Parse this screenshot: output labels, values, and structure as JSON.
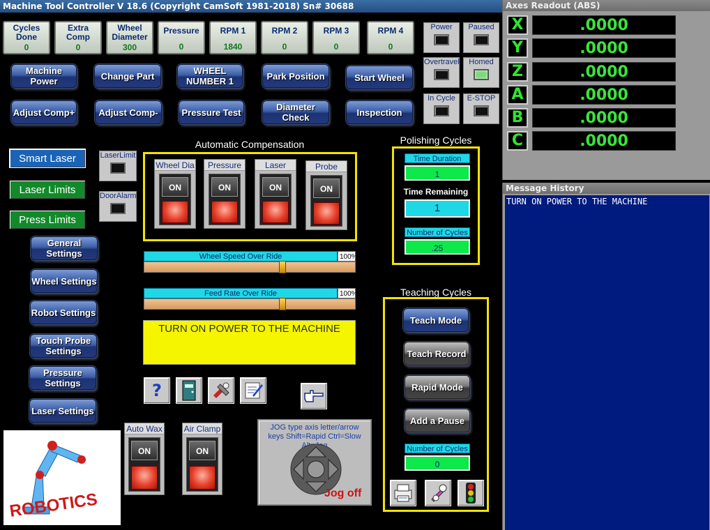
{
  "window_title": "Machine Tool Controller V 18.6 (Copyright CamSoft 1981-2018) Sn# 30688",
  "status": [
    {
      "label": "Cycles Done",
      "value": "0"
    },
    {
      "label": "Extra Comp",
      "value": "0"
    },
    {
      "label": "Wheel Diameter",
      "value": "300"
    },
    {
      "label": "Pressure",
      "value": "0"
    },
    {
      "label": "RPM 1",
      "value": "1840"
    },
    {
      "label": "RPM 2",
      "value": "0"
    },
    {
      "label": "RPM 3",
      "value": "0"
    },
    {
      "label": "RPM 4",
      "value": "0"
    }
  ],
  "indicators": {
    "power": "Power",
    "paused": "Paused",
    "overtravel": "Overtravel",
    "homed": "Homed",
    "in_cycle": "In Cycle",
    "estop": "E-STOP"
  },
  "buttons": {
    "machine_power": "Machine Power",
    "change_part": "Change Part",
    "wheel_number": "WHEEL NUMBER 1",
    "park_position": "Park Position",
    "start_wheel": "Start Wheel",
    "adjust_comp_plus": "Adjust Comp+",
    "adjust_comp_minus": "Adjust Comp-",
    "pressure_test": "Pressure Test",
    "diameter_check": "Diameter Check",
    "inspection": "Inspection"
  },
  "left_menu": {
    "smart_laser": "Smart Laser",
    "laser_limits": "Laser Limits",
    "press_limits": "Press Limits",
    "laser_limit_ind": "LaserLimit",
    "door_alarm_ind": "DoorAlarm"
  },
  "settings_buttons": [
    "General Settings",
    "Wheel Settings",
    "Robot Settings",
    "Touch Probe Settings",
    "Pressure Settings",
    "Laser Settings"
  ],
  "auto_comp": {
    "title": "Automatic Compensation",
    "toggles": [
      "Wheel Dia",
      "Pressure",
      "Laser",
      "Probe"
    ],
    "on_label": "ON"
  },
  "sliders": {
    "wheel_speed": {
      "label": "Wheel Speed Over Ride",
      "pct": "100%",
      "level": 0.66
    },
    "feed_rate": {
      "label": "Feed Rate Over Ride",
      "pct": "100%",
      "level": 0.66
    }
  },
  "message_box": "TURN ON POWER TO THE MACHINE",
  "bottom_toggles": [
    "Auto Wax",
    "Air Clamp"
  ],
  "jog": {
    "help": "JOG type axis letter/arrow keys Shift=Rapid Ctrl=Slow Alt=Jog",
    "status": "Jog off"
  },
  "polishing": {
    "title": "Polishing Cycles",
    "time_duration_label": "Time Duration",
    "time_duration_value": "1",
    "time_remaining_label": "Time Remaining",
    "time_remaining_value": "1",
    "num_cycles_label": "Number of Cycles",
    "num_cycles_value": ".25"
  },
  "teaching": {
    "title": "Teaching Cycles",
    "teach_mode": "Teach Mode",
    "teach_record": "Teach Record",
    "rapid_mode": "Rapid Mode",
    "add_pause": "Add a Pause",
    "num_cycles_label": "Number of Cycles",
    "num_cycles_value": "0"
  },
  "logo": {
    "text": "ROBOTICS"
  },
  "axes": {
    "title": "Axes Readout (ABS)",
    "rows": [
      {
        "letter": "X",
        "value": ".0000"
      },
      {
        "letter": "Y",
        "value": ".0000"
      },
      {
        "letter": "Z",
        "value": ".0000"
      },
      {
        "letter": "A",
        "value": ".0000"
      },
      {
        "letter": "B",
        "value": ".0000"
      },
      {
        "letter": "C",
        "value": ".0000"
      }
    ]
  },
  "message_history": {
    "title": "Message History",
    "lines": [
      "TURN ON POWER TO THE MACHINE"
    ]
  }
}
